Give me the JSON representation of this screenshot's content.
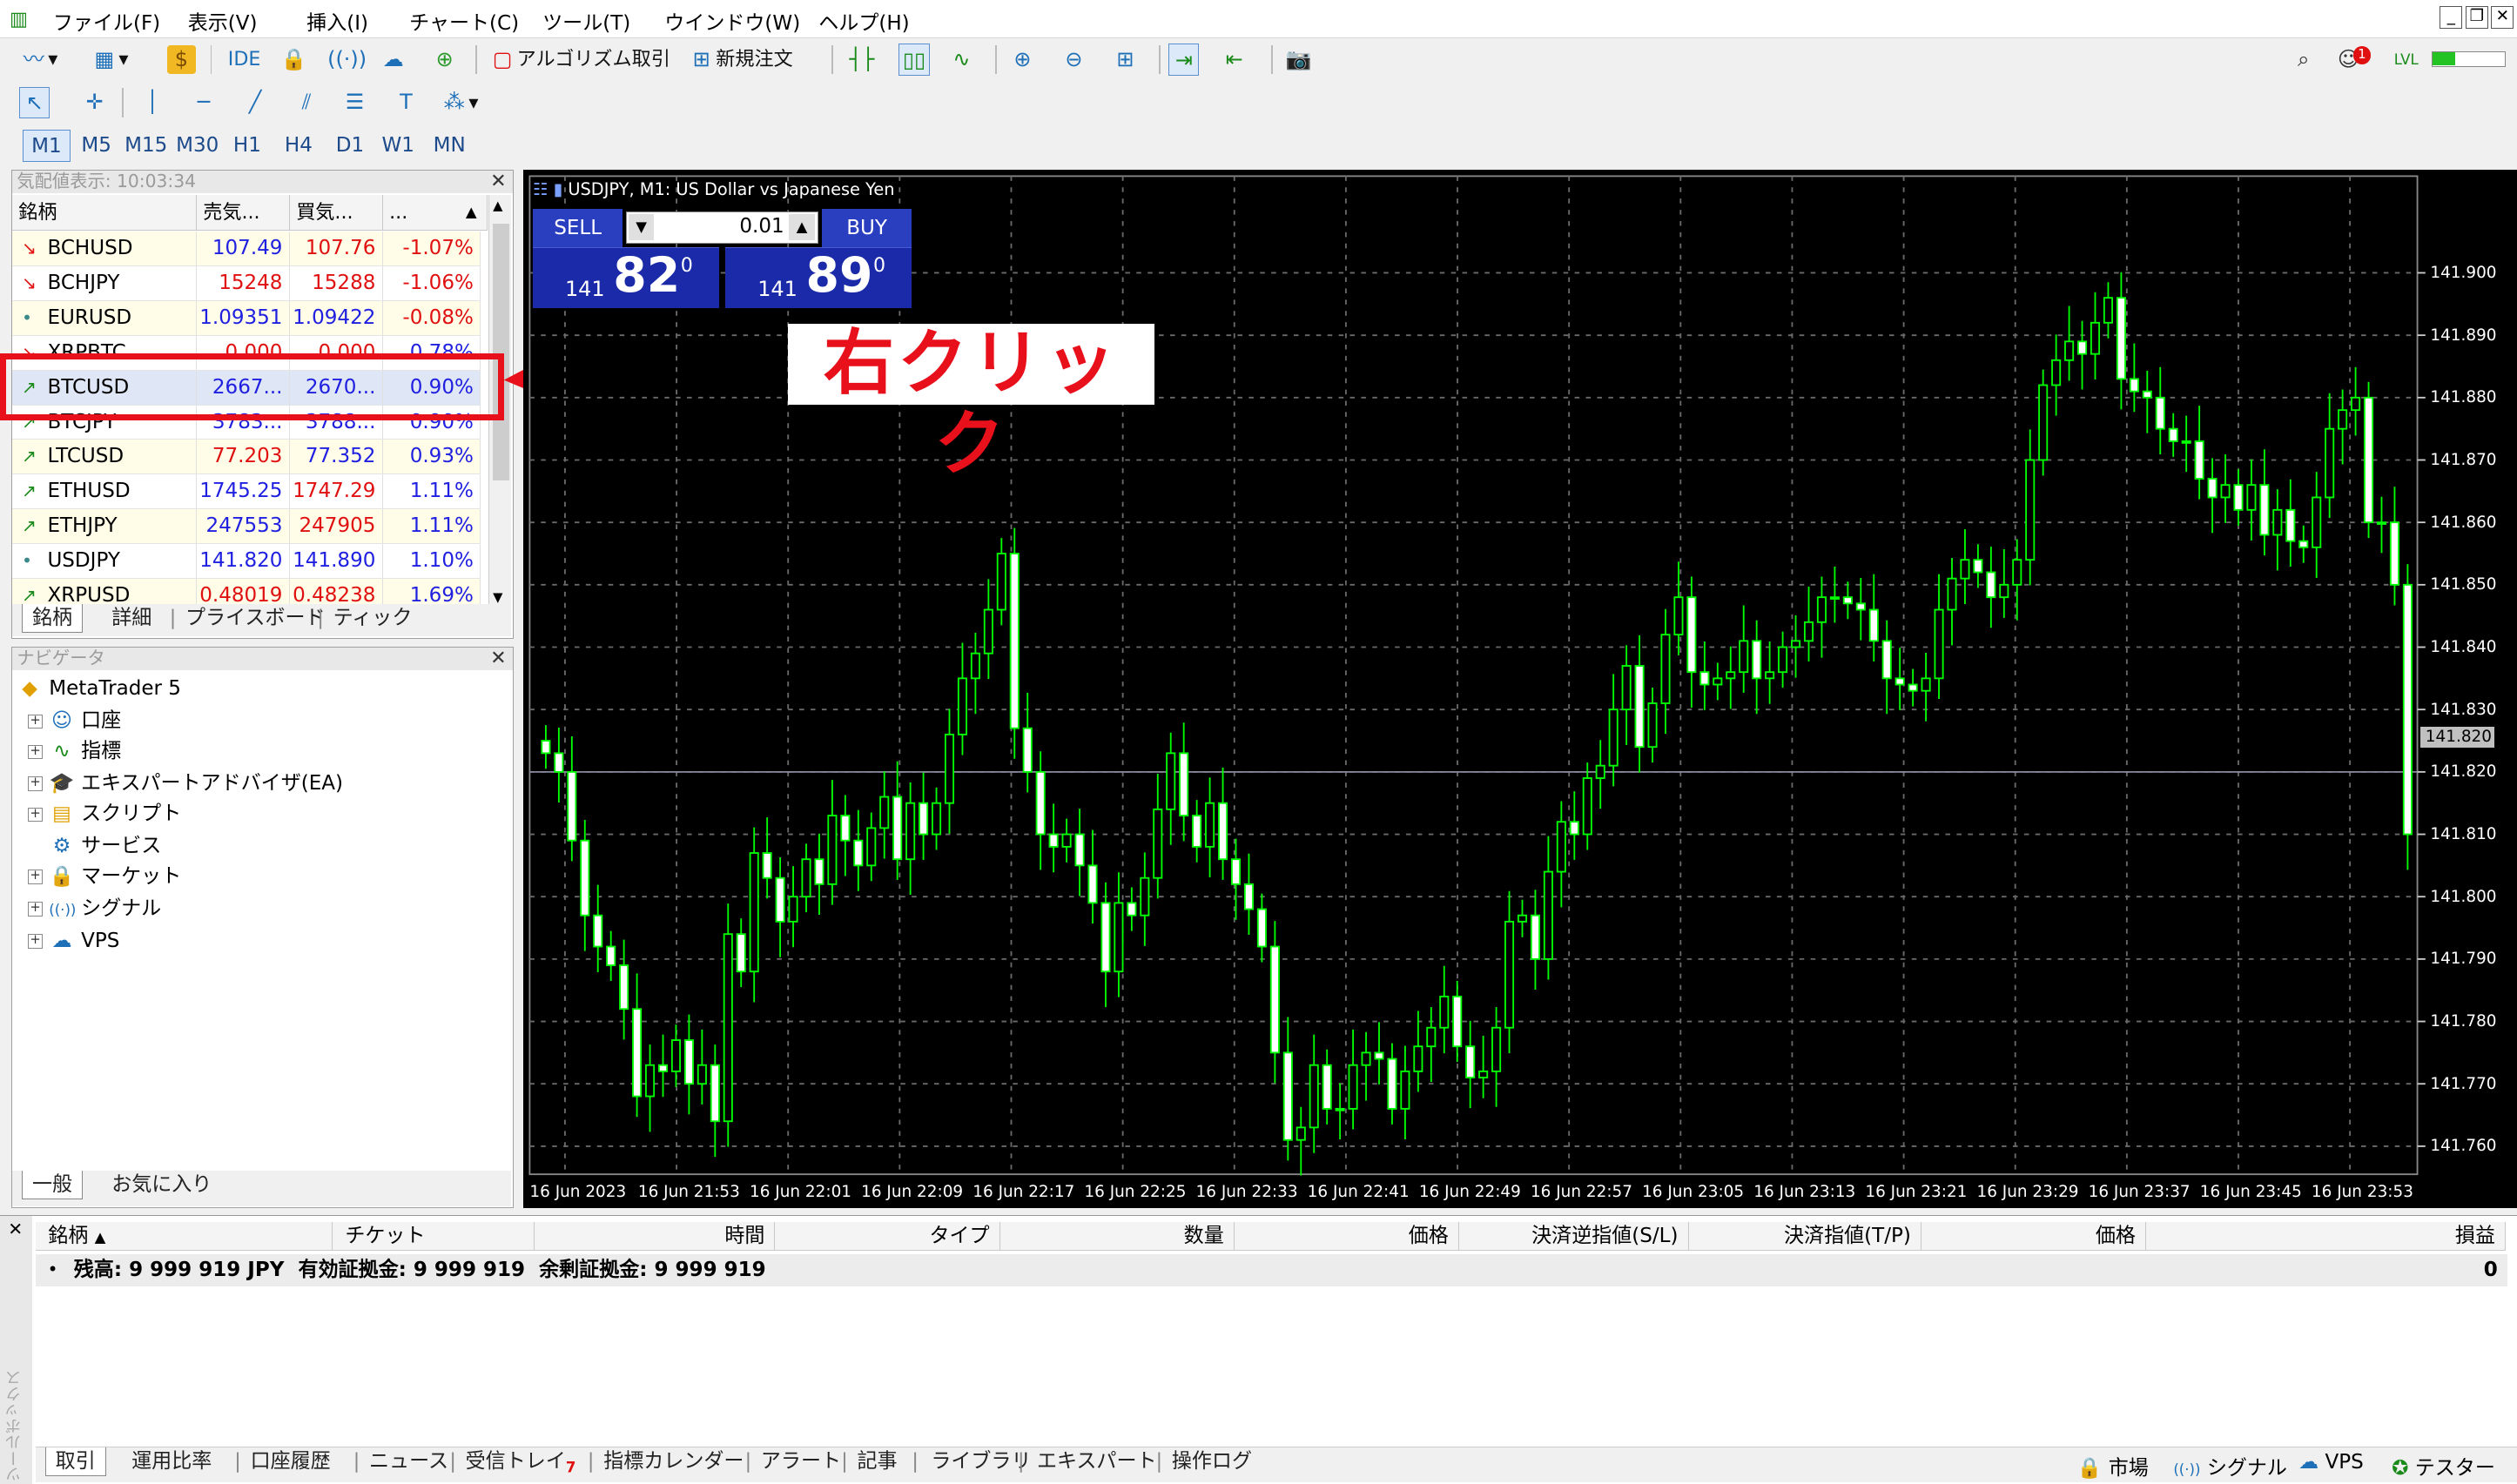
{
  "menu": [
    "ファイル(F)",
    "表示(V)",
    "挿入(I)",
    "チャート(C)",
    "ツール(T)",
    "ウインドウ(W)",
    "ヘルプ(H)"
  ],
  "toolbar": {
    "ide": "IDE",
    "algo": "アルゴリズム取引",
    "new_order": "新規注文"
  },
  "timeframes": [
    "M1",
    "M5",
    "M15",
    "M30",
    "H1",
    "H4",
    "D1",
    "W1",
    "MN"
  ],
  "market_watch": {
    "title": "気配値表示: 10:03:34",
    "headers": [
      "銘柄",
      "売気...",
      "買気...",
      "..."
    ],
    "rows": [
      {
        "symbol": "BCHUSD",
        "bid": "107.49",
        "ask": "107.76",
        "change": "-1.07%",
        "dir": "down"
      },
      {
        "symbol": "BCHJPY",
        "bid": "15248",
        "ask": "15288",
        "change": "-1.06%",
        "dir": "down"
      },
      {
        "symbol": "EURUSD",
        "bid": "1.09351",
        "ask": "1.09422",
        "change": "-0.08%",
        "dir": "flat"
      },
      {
        "symbol": "XRPBTC",
        "bid": "0.000",
        "ask": "0.000",
        "change": "0.78%",
        "dir": "down"
      },
      {
        "symbol": "BTCUSD",
        "bid": "2667...",
        "ask": "2670...",
        "change": "0.90%",
        "dir": "up"
      },
      {
        "symbol": "BTCJPY",
        "bid": "3783...",
        "ask": "3788...",
        "change": "0.90%",
        "dir": "up"
      },
      {
        "symbol": "LTCUSD",
        "bid": "77.203",
        "ask": "77.352",
        "change": "0.93%",
        "dir": "up"
      },
      {
        "symbol": "ETHUSD",
        "bid": "1745.25",
        "ask": "1747.29",
        "change": "1.11%",
        "dir": "up"
      },
      {
        "symbol": "ETHJPY",
        "bid": "247553",
        "ask": "247905",
        "change": "1.11%",
        "dir": "up"
      },
      {
        "symbol": "USDJPY",
        "bid": "141.820",
        "ask": "141.890",
        "change": "1.10%",
        "dir": "flat"
      },
      {
        "symbol": "XRPUSD",
        "bid": "0.48019",
        "ask": "0.48238",
        "change": "1.69%",
        "dir": "up"
      }
    ],
    "tabs": [
      "銘柄",
      "詳細",
      "プライスボード",
      "ティック"
    ]
  },
  "navigator": {
    "title": "ナビゲータ",
    "root": "MetaTrader 5",
    "items": [
      "口座",
      "指標",
      "エキスパートアドバイザ(EA)",
      "スクリプト",
      "サービス",
      "マーケット",
      "シグナル",
      "VPS"
    ],
    "tabs": [
      "一般",
      "お気に入り"
    ]
  },
  "annotation": {
    "label": "右クリック",
    "color": "#e8101a"
  },
  "chart": {
    "title": "USDJPY, M1:  US Dollar vs Japanese Yen",
    "sell": "SELL",
    "buy": "BUY",
    "volume": "0.01",
    "bid_prefix": "141",
    "bid_main": "82",
    "bid_sup": "0",
    "ask_prefix": "141",
    "ask_main": "89",
    "ask_sup": "0",
    "current_price": "141.820"
  },
  "chart_data": {
    "type": "candlestick",
    "symbol": "USDJPY",
    "timeframe": "M1",
    "y_ticks": [
      "141.900",
      "141.890",
      "141.880",
      "141.870",
      "141.860",
      "141.850",
      "141.840",
      "141.830",
      "141.820",
      "141.810",
      "141.800",
      "141.790",
      "141.780",
      "141.770",
      "141.760"
    ],
    "x_ticks": [
      "16 Jun 2023",
      "16 Jun 21:53",
      "16 Jun 22:01",
      "16 Jun 22:09",
      "16 Jun 22:17",
      "16 Jun 22:25",
      "16 Jun 22:33",
      "16 Jun 22:41",
      "16 Jun 22:49",
      "16 Jun 22:57",
      "16 Jun 23:05",
      "16 Jun 23:13",
      "16 Jun 23:21",
      "16 Jun 23:29",
      "16 Jun 23:37",
      "16 Jun 23:45",
      "16 Jun 23:53"
    ],
    "ylim": [
      141.7555,
      141.9155
    ],
    "colors": {
      "up": "#ffffff",
      "down": "#ffffff",
      "wick": "#00ff00",
      "grid": "#6a6a6a",
      "bg": "#000000"
    },
    "closes": [
      141.823,
      141.82,
      141.809,
      141.797,
      141.792,
      141.789,
      141.782,
      141.768,
      141.773,
      141.772,
      141.777,
      141.77,
      141.773,
      141.764,
      141.794,
      141.788,
      141.807,
      141.803,
      141.796,
      141.8,
      141.806,
      141.802,
      141.813,
      141.809,
      141.805,
      141.811,
      141.816,
      141.806,
      141.815,
      141.81,
      141.815,
      141.826,
      141.835,
      141.839,
      141.846,
      141.855,
      141.827,
      141.82,
      141.81,
      141.808,
      141.81,
      141.805,
      141.799,
      141.788,
      141.799,
      141.797,
      141.803,
      141.814,
      141.823,
      141.813,
      141.808,
      141.815,
      141.806,
      141.802,
      141.798,
      141.792,
      141.775,
      141.761,
      141.763,
      141.773,
      141.766,
      141.766,
      141.773,
      141.775,
      141.774,
      141.766,
      141.772,
      141.776,
      141.779,
      141.784,
      141.776,
      141.771,
      141.772,
      141.779,
      141.796,
      141.797,
      141.79,
      141.804,
      141.812,
      141.81,
      141.819,
      141.821,
      141.83,
      141.837,
      141.824,
      141.831,
      141.842,
      141.848,
      141.836,
      141.834,
      141.835,
      141.836,
      141.841,
      141.835,
      141.836,
      141.84,
      141.841,
      141.844,
      141.848,
      141.848,
      141.847,
      141.846,
      141.841,
      141.835,
      141.834,
      141.833,
      141.835,
      141.846,
      141.851,
      141.854,
      141.852,
      141.848,
      141.85,
      141.854,
      141.87,
      141.882,
      141.886,
      141.889,
      141.887,
      141.892,
      141.896,
      141.883,
      141.881,
      141.88,
      141.875,
      141.873,
      141.873,
      141.867,
      141.864,
      141.866,
      141.862,
      141.866,
      141.858,
      141.862,
      141.857,
      141.856,
      141.864,
      141.875,
      141.878,
      141.88,
      141.86,
      141.86,
      141.85,
      141.81
    ]
  },
  "terminal": {
    "headers": [
      "銘柄",
      "チケット",
      "時間",
      "タイプ",
      "数量",
      "価格",
      "決済逆指値(S/L)",
      "決済指値(T/P)",
      "価格",
      "損益"
    ],
    "balance": "残高: 9 999 919 JPY  有効証拠金: 9 999 919  余剰証拠金: 9 999 919",
    "profit": "0",
    "tabs": [
      "取引",
      "運用比率",
      "口座履歴",
      "ニュース",
      "受信トレイ",
      "指標カレンダー",
      "アラート",
      "記事",
      "ライブラリ",
      "エキスパート",
      "操作ログ"
    ],
    "inbox_badge": "7",
    "side_label": "ツールボックス"
  },
  "status": [
    "市場",
    "シグナル",
    "VPS",
    "テスター"
  ],
  "notif_badge": "1"
}
